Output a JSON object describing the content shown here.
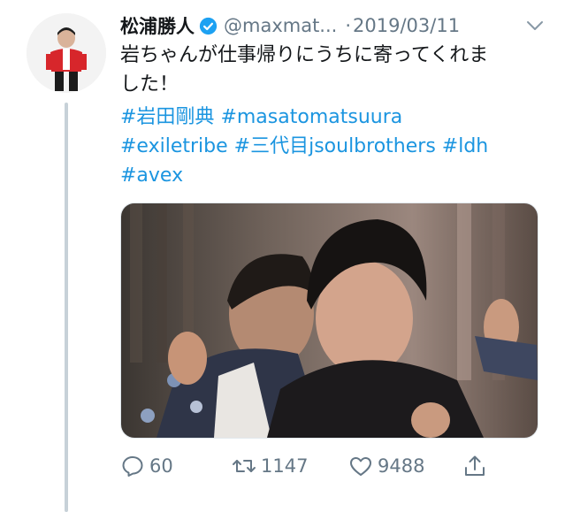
{
  "tweet": {
    "author_name": "松浦勝人",
    "handle": "@maxmat...",
    "separator": "·",
    "date": "2019/03/11",
    "text_lines": [
      "岩ちゃんが仕事帰りにうちに寄ってくれま",
      "した！"
    ],
    "hashtag_lines": [
      [
        "#岩田剛典",
        "#masatomatsuura"
      ],
      [
        "#exiletribe",
        "#三代目jsoulbrothers",
        "#ldh"
      ],
      [
        "#avex"
      ]
    ]
  },
  "actions": {
    "reply_count": "60",
    "retweet_count": "1147",
    "like_count": "9488"
  },
  "colors": {
    "link": "#1b95e0",
    "muted": "#657786",
    "verified": "#1da1f2",
    "thread_line": "#c7d1d8"
  },
  "icons": [
    "verified-badge-icon",
    "chevron-down-icon",
    "reply-icon",
    "retweet-icon",
    "like-icon",
    "share-icon"
  ]
}
